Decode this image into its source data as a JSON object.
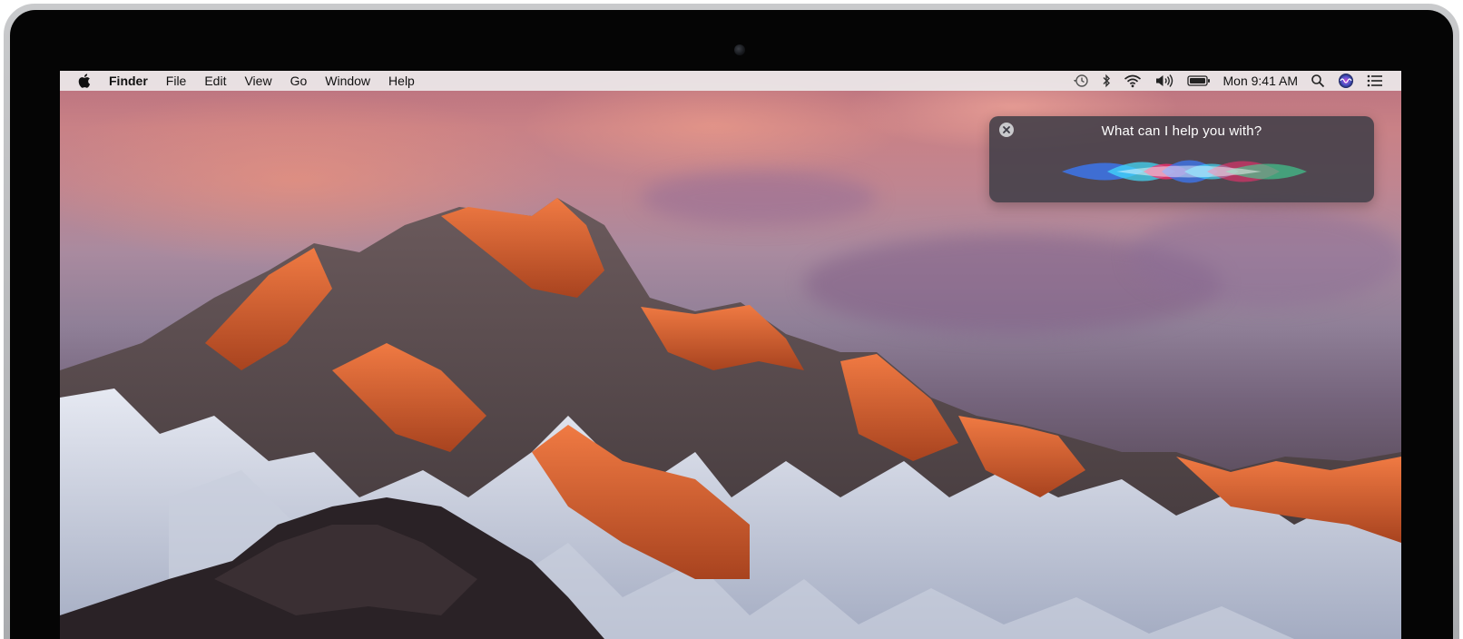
{
  "menubar": {
    "app_name": "Finder",
    "menus": [
      "File",
      "Edit",
      "View",
      "Go",
      "Window",
      "Help"
    ],
    "status_icons": [
      "time-machine-icon",
      "bluetooth-icon",
      "wifi-icon",
      "volume-icon",
      "battery-icon"
    ],
    "clock": "Mon 9:41 AM",
    "right_icons": [
      "spotlight-search-icon",
      "siri-icon",
      "notification-center-icon"
    ]
  },
  "siri": {
    "prompt": "What can I help you with?",
    "wave_colors": [
      "#3a7bff",
      "#ff2d6f",
      "#41e0ff",
      "#3ddc97"
    ]
  },
  "colors": {
    "menubar_bg": "#ece8ea",
    "siri_panel_bg": "#3e3c46"
  }
}
